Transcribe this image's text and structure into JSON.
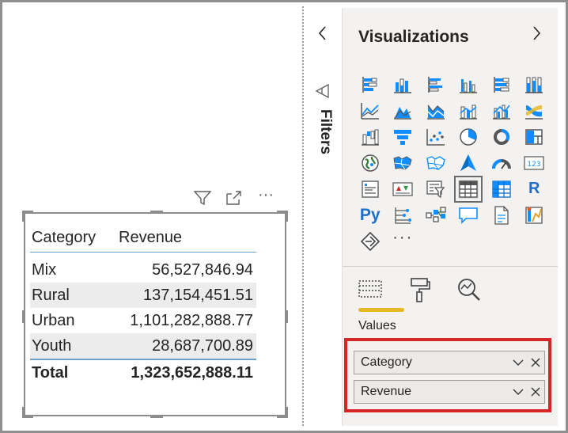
{
  "table": {
    "headers": [
      "Category",
      "Revenue"
    ],
    "rows": [
      {
        "category": "Mix",
        "revenue": "56,527,846.94"
      },
      {
        "category": "Rural",
        "revenue": "137,154,451.51"
      },
      {
        "category": "Urban",
        "revenue": "1,101,282,888.77"
      },
      {
        "category": "Youth",
        "revenue": "28,687,700.89"
      }
    ],
    "total": {
      "label": "Total",
      "revenue": "1,323,652,888.11"
    }
  },
  "visual_header": {
    "icons": [
      "filter-icon",
      "focus-mode-icon",
      "more-options-icon"
    ],
    "more_glyph": "···"
  },
  "filters": {
    "label": "Filters"
  },
  "visualizations": {
    "title": "Visualizations",
    "more_glyph": "···",
    "gallery": [
      [
        "stacked-bar-chart-icon",
        "stacked-column-chart-icon",
        "clustered-bar-chart-icon",
        "clustered-column-chart-icon",
        "100-stacked-bar-chart-icon",
        "100-stacked-column-chart-icon"
      ],
      [
        "line-chart-icon",
        "area-chart-icon",
        "stacked-area-chart-icon",
        "line-and-stacked-column-chart-icon",
        "line-and-clustered-column-chart-icon",
        "ribbon-chart-icon"
      ],
      [
        "waterfall-chart-icon",
        "funnel-chart-icon",
        "scatter-chart-icon",
        "pie-chart-icon",
        "donut-chart-icon",
        "treemap-icon"
      ],
      [
        "map-icon",
        "filled-map-icon",
        "shape-map-icon",
        "azure-map-icon",
        "gauge-icon",
        "card-icon"
      ],
      [
        "multi-row-card-icon",
        "kpi-icon",
        "slicer-icon",
        "table-icon",
        "matrix-icon",
        "r-visual-icon"
      ],
      [
        "python-visual-icon",
        "key-influencers-icon",
        "decomposition-tree-icon",
        "qa-icon",
        "smart-narrative-icon",
        "paginated-report-icon"
      ],
      [
        "power-apps-icon",
        "more-visuals-icon"
      ]
    ],
    "selected": "table-icon",
    "card_text": "123",
    "r_text": "R",
    "py_text": "Py",
    "tabs": [
      "fields-tab-icon",
      "format-tab-icon",
      "analytics-tab-icon"
    ],
    "values_label": "Values",
    "fields": [
      {
        "name": "Category"
      },
      {
        "name": "Revenue"
      }
    ]
  },
  "colors": {
    "accent_blue": "#118dff",
    "dark_gray": "#605e5c",
    "highlight_red": "#d62626",
    "tab_underline": "#e8b824",
    "table_rule": "#6aa0c9"
  }
}
